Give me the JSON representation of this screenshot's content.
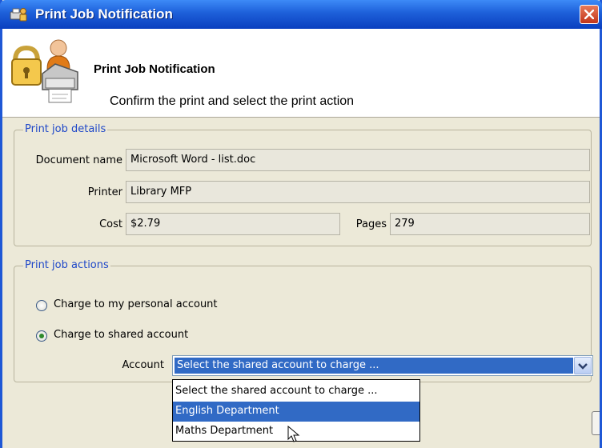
{
  "window": {
    "title": "Print Job Notification"
  },
  "header": {
    "title": "Print Job Notification",
    "subtitle": "Confirm the print and select the print action"
  },
  "details": {
    "legend": "Print job details",
    "document_label": "Document name",
    "document_value": "Microsoft Word - list.doc",
    "printer_label": "Printer",
    "printer_value": "Library MFP",
    "cost_label": "Cost",
    "cost_value": "$2.79",
    "pages_label": "Pages",
    "pages_value": "279"
  },
  "actions": {
    "legend": "Print job actions",
    "personal_label": "Charge to my personal account",
    "shared_label": "Charge to shared account",
    "selected": "shared",
    "account_label": "Account",
    "account_selected": "Select the shared account to charge ...",
    "options": [
      "Select the shared account to charge ...",
      "English Department",
      "Maths Department"
    ],
    "highlighted_option": "English Department"
  },
  "icons": {
    "app": "printer-lock-icon",
    "header": "printer-with-users-icon",
    "close": "close-icon",
    "dropdown": "chevron-down-icon",
    "cursor": "mouse-pointer-icon"
  },
  "colors": {
    "titlebar": "#1d5fd9",
    "selection": "#316ac5",
    "legend_text": "#1f48c8",
    "dialog_bg": "#ece9d8"
  }
}
